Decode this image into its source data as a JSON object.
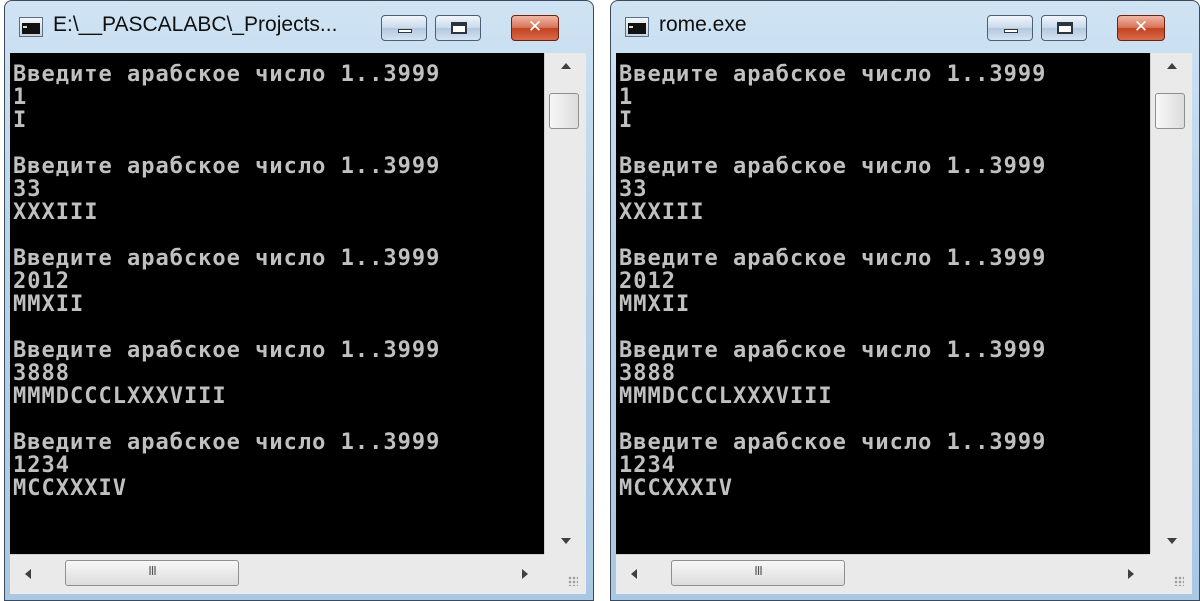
{
  "windows": [
    {
      "title": "E:\\__PASCALABC\\_Projects...",
      "lines": [
        "Введите арабское число 1..3999",
        "1",
        "I",
        "",
        "Введите арабское число 1..3999",
        "33",
        "XXXIII",
        "",
        "Введите арабское число 1..3999",
        "2012",
        "MMXII",
        "",
        "Введите арабское число 1..3999",
        "3888",
        "MMMDCCCLXXXVIII",
        "",
        "Введите арабское число 1..3999",
        "1234",
        "MCCXXXIV"
      ],
      "hscroll_grip": "III"
    },
    {
      "title": "rome.exe",
      "lines": [
        "Введите арабское число 1..3999",
        "1",
        "I",
        "",
        "Введите арабское число 1..3999",
        "33",
        "XXXIII",
        "",
        "Введите арабское число 1..3999",
        "2012",
        "MMXII",
        "",
        "Введите арабское число 1..3999",
        "3888",
        "MMMDCCCLXXXVIII",
        "",
        "Введите арабское число 1..3999",
        "1234",
        "MCCXXXIV"
      ],
      "hscroll_grip": "III"
    }
  ],
  "caption_buttons": {
    "close_glyph": "✕"
  },
  "colors": {
    "console_bg": "#000000",
    "console_text": "#c0c0c0",
    "close_button": "#c2421f",
    "frame": "#b9d3ea"
  },
  "icons": {
    "app": "console-app-icon",
    "minimize": "minimize-icon",
    "maximize": "maximize-icon",
    "close": "close-icon"
  }
}
